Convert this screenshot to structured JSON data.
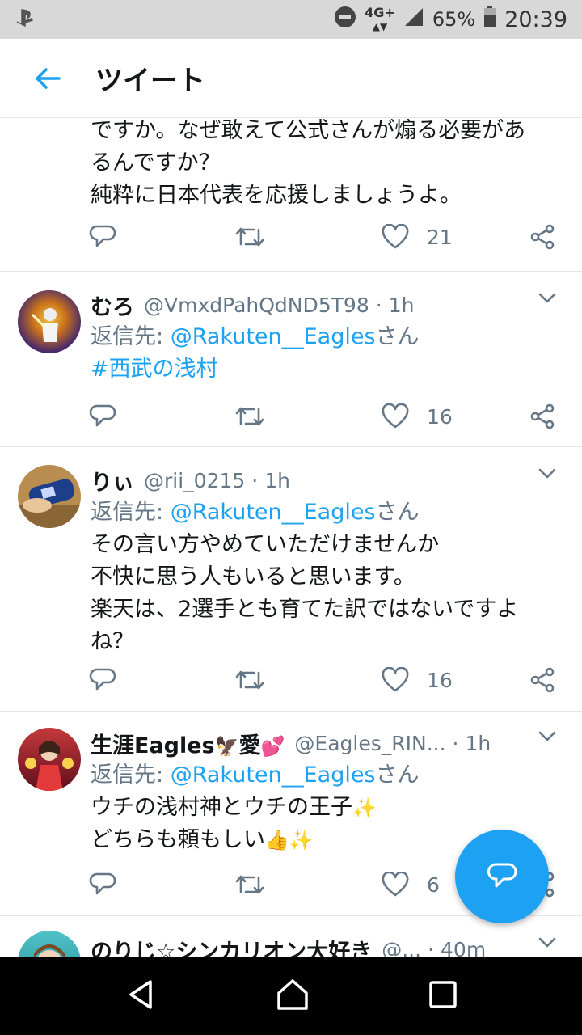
{
  "status_bar": {
    "network": "4G+",
    "battery": "65%",
    "time": "20:39"
  },
  "app_bar": {
    "title": "ツイート",
    "back_icon": "arrow-left-icon"
  },
  "tweets": [
    {
      "lines": [
        "ですか。なぜ敢えて公式さんが煽る必要があ",
        "るんですか？",
        "純粋に日本代表を応援しましょうよ。"
      ],
      "likes": "21"
    },
    {
      "name": "むろ",
      "handle": "@VmxdPahQdND5T98",
      "time": "1h",
      "reply_prefix": "返信先: ",
      "reply_to": "@Rakuten__Eagles",
      "reply_suffix": "さん",
      "lines": [
        "#西武の浅村"
      ],
      "likes": "16"
    },
    {
      "name": "りぃ",
      "handle": "@rii_0215",
      "time": "1h",
      "reply_prefix": "返信先: ",
      "reply_to": "@Rakuten__Eagles",
      "reply_suffix": "さん",
      "lines": [
        "その言い方やめていただけませんか",
        "不快に思う人もいると思います。",
        "楽天は、2選手とも育てた訳ではないですよ",
        "ね？"
      ],
      "likes": "16"
    },
    {
      "name": "生涯Eagles",
      "name_emoji_1": "🦅",
      "name_2": "愛",
      "name_emoji_2": "💕",
      "handle": "@Eagles_RIN...",
      "time": "1h",
      "reply_prefix": "返信先: ",
      "reply_to": "@Rakuten__Eagles",
      "reply_suffix": "さん",
      "line1": "ウチの浅村神とウチの王子",
      "line1_emoji": "✨",
      "line2": "どちらも頼もしい",
      "line2_emoji": "👍✨",
      "likes": "6"
    },
    {
      "name": "のりじ☆シンカリオン大好き",
      "handle": "@...",
      "time": "40m"
    }
  ],
  "colors": {
    "accent": "#1da1f2",
    "secondary_text": "#657786",
    "divider": "#e1e8ed"
  }
}
